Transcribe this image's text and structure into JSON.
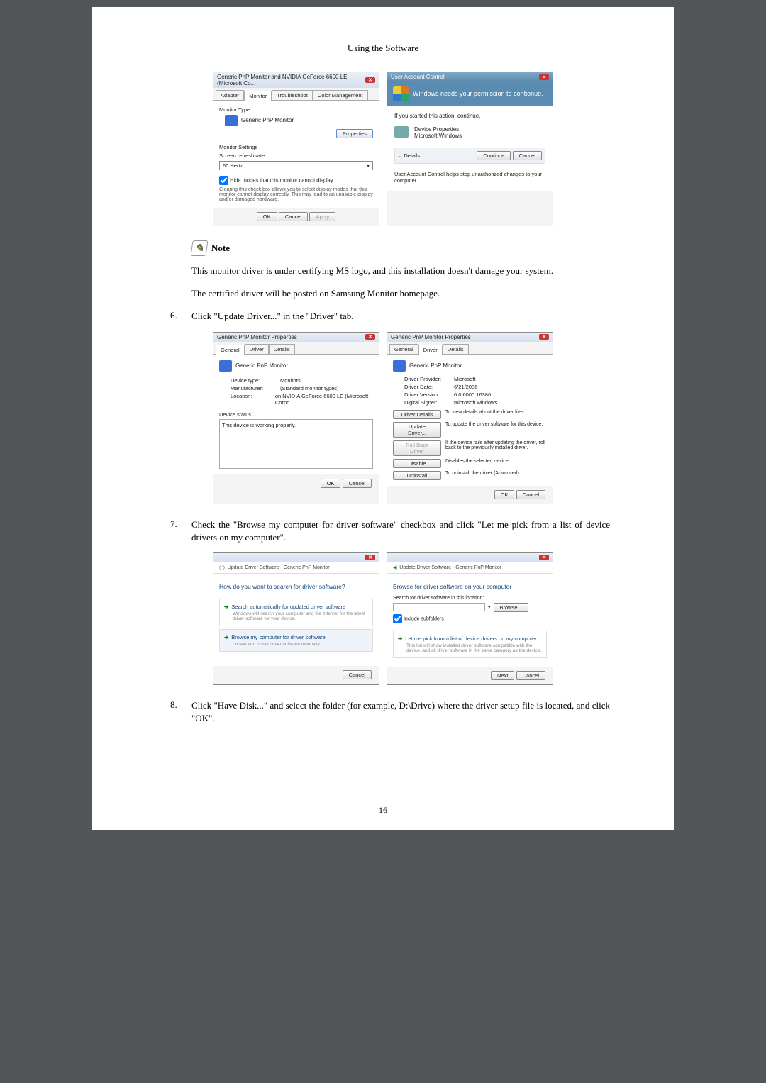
{
  "header_title": "Using the Software",
  "dlg_monitor": {
    "title": "Generic PnP Monitor and NVIDIA GeForce 6600 LE (Microsoft Co...",
    "tabs": [
      "Adapter",
      "Monitor",
      "Troubleshoot",
      "Color Management"
    ],
    "section1_label": "Monitor Type",
    "monitor_name": "Generic PnP Monitor",
    "properties_btn": "Properties",
    "section2_label": "Monitor Settings",
    "refresh_label": "Screen refresh rate:",
    "refresh_value": "60 Hertz",
    "hide_modes_label": "Hide modes that this monitor cannot display",
    "hide_modes_desc": "Clearing this check box allows you to select display modes that this monitor cannot display correctly. This may lead to an unusable display and/or damaged hardware.",
    "ok": "OK",
    "cancel": "Cancel",
    "apply": "Apply"
  },
  "uac": {
    "title": "User Account Control",
    "banner": "Windows needs your permission to contionue.",
    "started": "If you started this action, continue.",
    "dev_props": "Device Properties",
    "ms_windows": "Microsoft Windows",
    "details": "Details",
    "continue": "Continue",
    "cancel": "Cancel",
    "footer": "User Account Control helps stop unauthorized changes to your computer."
  },
  "note_label": "Note",
  "note_text1": "This monitor driver is under certifying MS logo, and this installation doesn't damage your system.",
  "note_text2": "The certified driver will be posted on Samsung Monitor homepage.",
  "step6": {
    "num": "6.",
    "text": "Click \"Update Driver...\" in the \"Driver\" tab."
  },
  "props_general": {
    "title": "Generic PnP Monitor Properties",
    "tabs": [
      "General",
      "Driver",
      "Details"
    ],
    "name": "Generic PnP Monitor",
    "device_type_k": "Device type:",
    "device_type_v": "Monitors",
    "manufacturer_k": "Manufacturer:",
    "manufacturer_v": "(Standard monitor types)",
    "location_k": "Location:",
    "location_v": "on NVIDIA GeForce 6600 LE (Microsoft Corpo",
    "status_label": "Device status",
    "status_text": "This device is working properly.",
    "ok": "OK",
    "cancel": "Cancel"
  },
  "props_driver": {
    "title": "Generic PnP Monitor Properties",
    "tabs": [
      "General",
      "Driver",
      "Details"
    ],
    "name": "Generic PnP Monitor",
    "provider_k": "Driver Provider:",
    "provider_v": "Microsoft",
    "date_k": "Driver Date:",
    "date_v": "6/21/2006",
    "version_k": "Driver Version:",
    "version_v": "6.0.6000.16386",
    "signer_k": "Digital Signer:",
    "signer_v": "microsoft windows",
    "btn_details": "Driver Details",
    "btn_details_desc": "To view details about the driver files.",
    "btn_update": "Update Driver...",
    "btn_update_desc": "To update the driver software for this device.",
    "btn_rollback": "Roll Back Driver",
    "btn_rollback_desc": "If the device fails after updating the driver, roll back to the previously installed driver.",
    "btn_disable": "Disable",
    "btn_disable_desc": "Disables the selected device.",
    "btn_uninstall": "Uninstall",
    "btn_uninstall_desc": "To uninstall the driver (Advanced).",
    "ok": "OK",
    "cancel": "Cancel"
  },
  "step7": {
    "num": "7.",
    "text": "Check the \"Browse my computer for driver software\" checkbox and click \"Let me pick from a list of device drivers on my computer\"."
  },
  "wiz1": {
    "crumb": "Update Driver Software - Generic PnP Monitor",
    "heading": "How do you want to search for driver software?",
    "opt1_label": "Search automatically for updated driver software",
    "opt1_sub": "Windows will search your computer and the Internet for the latest driver software for your device.",
    "opt2_label": "Browse my computer for driver software",
    "opt2_sub": "Locate and install driver software manually.",
    "cancel": "Cancel"
  },
  "wiz2": {
    "crumb": "Update Driver Software - Generic PnP Monitor",
    "heading": "Browse for driver software on your computer",
    "search_label": "Search for driver software in this location:",
    "browse": "Browse...",
    "include_sub": "Include subfolders",
    "opt_label": "Let me pick from a list of device drivers on my computer",
    "opt_sub": "This list will show installed driver software compatible with the device, and all driver software in the same category as the device.",
    "next": "Next",
    "cancel": "Cancel"
  },
  "step8": {
    "num": "8.",
    "text": "Click \"Have Disk...\" and select the folder (for example, D:\\Drive) where the driver setup file is located, and click \"OK\"."
  },
  "page_number": "16"
}
